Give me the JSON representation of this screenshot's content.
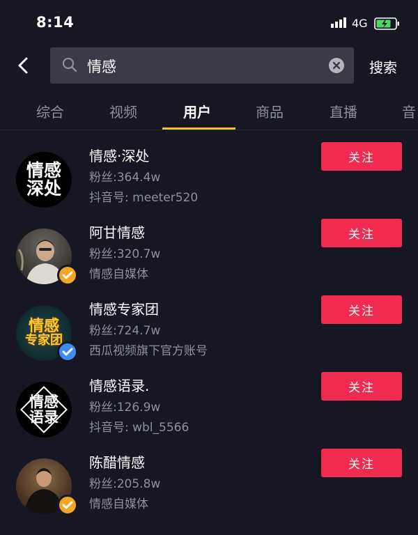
{
  "status_bar": {
    "time": "8:14",
    "network": "4G"
  },
  "search": {
    "query": "情感",
    "submit_label": "搜索"
  },
  "tabs": [
    {
      "label": "综合"
    },
    {
      "label": "视频"
    },
    {
      "label": "用户"
    },
    {
      "label": "商品"
    },
    {
      "label": "直播"
    },
    {
      "label": "音"
    }
  ],
  "active_tab": "用户",
  "accent_colors": {
    "follow_button": "#f12a4f",
    "tab_underline": "#f2c42b",
    "verified_gold": "#f5a623",
    "verified_blue": "#3c8df0"
  },
  "users": [
    {
      "name": "情感·深处",
      "fans": "粉丝:364.4w",
      "sub": "抖音号: meeter520",
      "follow_label": "关注",
      "avatar_text": [
        "情感",
        "深处"
      ],
      "badge": "none"
    },
    {
      "name": "阿甘情感",
      "fans": "粉丝:320.7w",
      "sub": "情感自媒体",
      "follow_label": "关注",
      "avatar_text": [],
      "badge": "gold"
    },
    {
      "name": "情感专家团",
      "fans": "粉丝:724.7w",
      "sub": "西瓜视频旗下官方账号",
      "follow_label": "关注",
      "avatar_text": [
        "情感",
        "专家团"
      ],
      "badge": "blue"
    },
    {
      "name": "情感语录.",
      "fans": "粉丝:126.9w",
      "sub": "抖音号: wbl_5566",
      "follow_label": "关注",
      "avatar_text": [
        "情感",
        "语录"
      ],
      "badge": "none"
    },
    {
      "name": "陈醋情感",
      "fans": "粉丝:205.8w",
      "sub": "情感自媒体",
      "follow_label": "关注",
      "avatar_text": [],
      "badge": "gold"
    }
  ]
}
